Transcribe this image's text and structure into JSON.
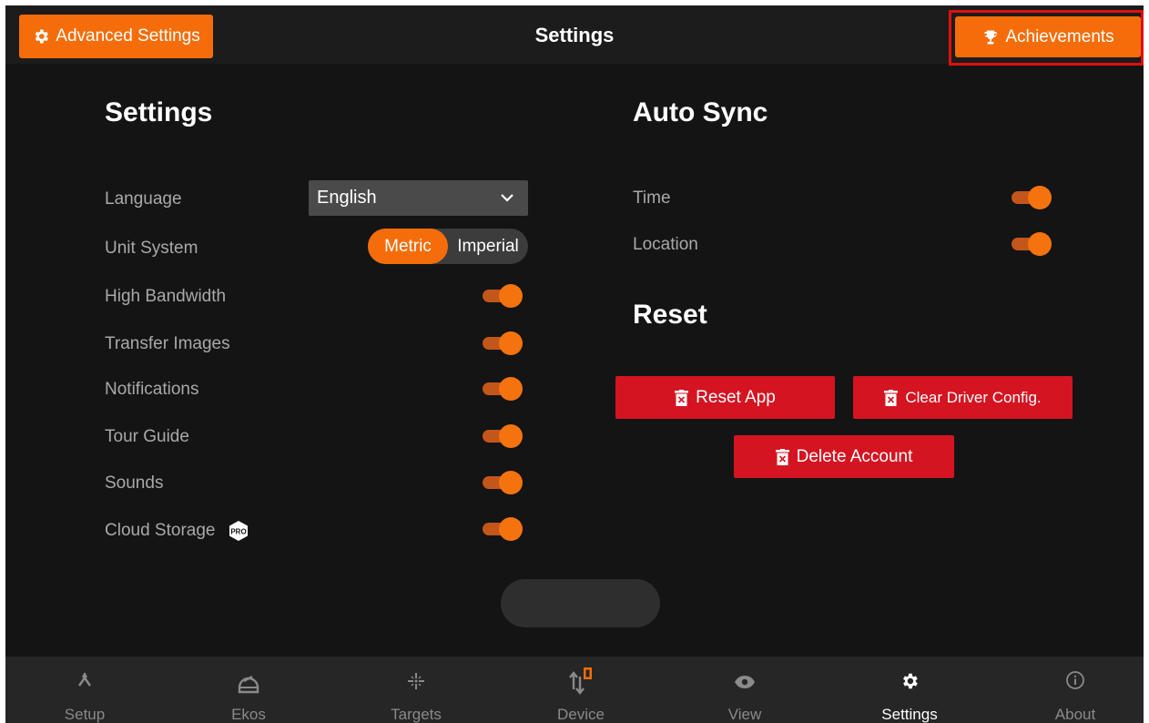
{
  "topbar": {
    "advanced_label": "Advanced Settings",
    "title": "Settings",
    "achievements_label": "Achievements"
  },
  "settings": {
    "heading": "Settings",
    "language_label": "Language",
    "language_value": "English",
    "unit_label": "Unit System",
    "unit_options": [
      "Metric",
      "Imperial"
    ],
    "unit_selected": "Metric",
    "toggles": [
      {
        "label": "High Bandwidth",
        "on": true
      },
      {
        "label": "Transfer Images",
        "on": true
      },
      {
        "label": "Notifications",
        "on": true
      },
      {
        "label": "Tour Guide",
        "on": true
      },
      {
        "label": "Sounds",
        "on": true
      },
      {
        "label": "Cloud Storage",
        "on": true,
        "badge": "PRO"
      }
    ]
  },
  "autosync": {
    "heading": "Auto Sync",
    "items": [
      {
        "label": "Time",
        "on": true
      },
      {
        "label": "Location",
        "on": true
      }
    ]
  },
  "reset": {
    "heading": "Reset",
    "reset_app": "Reset App",
    "clear_driver": "Clear Driver Config.",
    "delete_account": "Delete Account"
  },
  "nav": [
    {
      "label": "Setup",
      "icon": "setup-icon"
    },
    {
      "label": "Ekos",
      "icon": "ekos-icon"
    },
    {
      "label": "Targets",
      "icon": "targets-icon"
    },
    {
      "label": "Device",
      "icon": "device-icon"
    },
    {
      "label": "View",
      "icon": "eye-icon"
    },
    {
      "label": "Settings",
      "icon": "gear-icon",
      "active": true
    },
    {
      "label": "About",
      "icon": "info-icon"
    }
  ],
  "colors": {
    "accent": "#f56d0a",
    "danger": "#d41421",
    "background": "#141414"
  }
}
